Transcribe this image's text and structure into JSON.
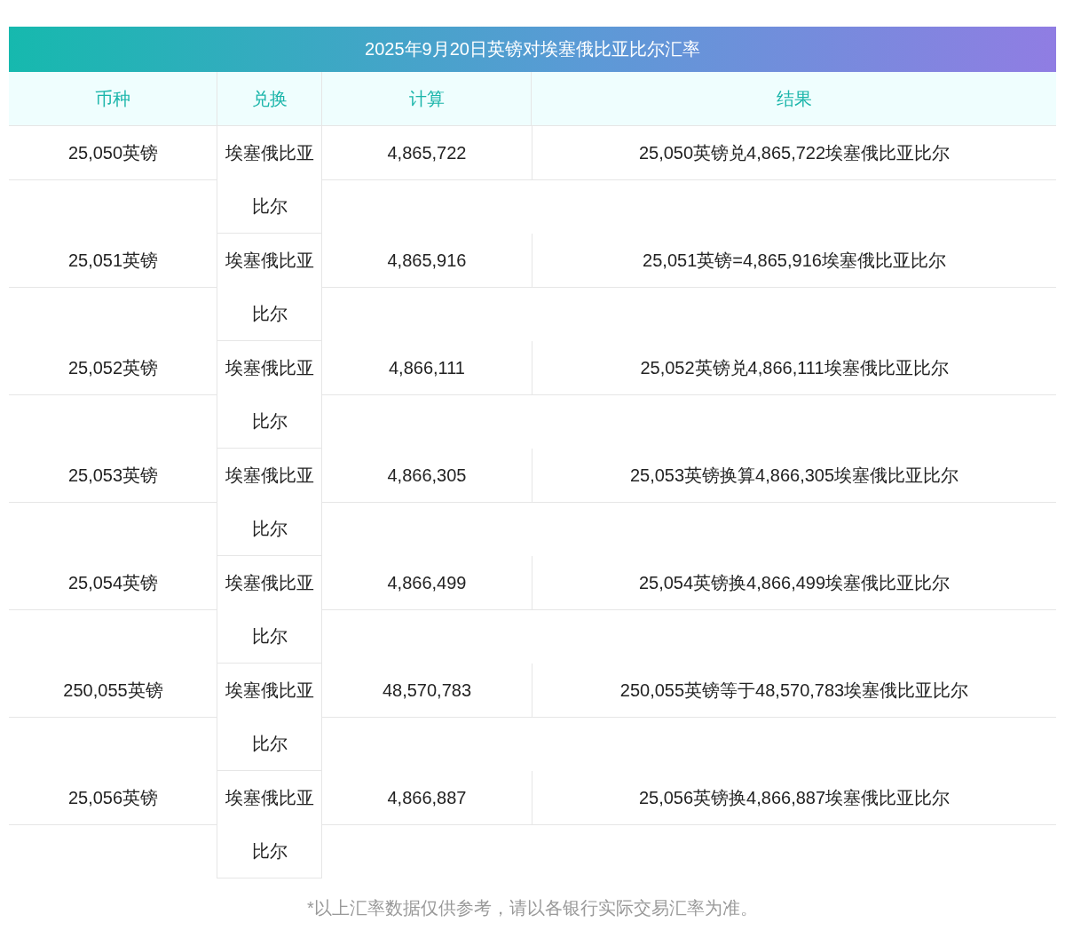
{
  "title": "2025年9月20日英镑对埃塞俄比亚比尔汇率",
  "columns": [
    "币种",
    "兑换",
    "计算",
    "结果"
  ],
  "rows": [
    {
      "currency": "25,050英镑",
      "exchange": "埃塞俄比亚比尔",
      "amount": "4,865,722",
      "result": "25,050英镑兑4,865,722埃塞俄比亚比尔"
    },
    {
      "currency": "25,051英镑",
      "exchange": "埃塞俄比亚比尔",
      "amount": "4,865,916",
      "result": "25,051英镑=4,865,916埃塞俄比亚比尔"
    },
    {
      "currency": "25,052英镑",
      "exchange": "埃塞俄比亚比尔",
      "amount": "4,866,111",
      "result": "25,052英镑兑4,866,111埃塞俄比亚比尔"
    },
    {
      "currency": "25,053英镑",
      "exchange": "埃塞俄比亚比尔",
      "amount": "4,866,305",
      "result": "25,053英镑换算4,866,305埃塞俄比亚比尔"
    },
    {
      "currency": "25,054英镑",
      "exchange": "埃塞俄比亚比尔",
      "amount": "4,866,499",
      "result": "25,054英镑换4,866,499埃塞俄比亚比尔"
    },
    {
      "currency": "250,055英镑",
      "exchange": "埃塞俄比亚比尔",
      "amount": "48,570,783",
      "result": "250,055英镑等于48,570,783埃塞俄比亚比尔"
    },
    {
      "currency": "25,056英镑",
      "exchange": "埃塞俄比亚比尔",
      "amount": "4,866,887",
      "result": "25,056英镑换4,866,887埃塞俄比亚比尔"
    }
  ],
  "note": "*以上汇率数据仅供参考，请以各银行实际交易汇率为准。"
}
